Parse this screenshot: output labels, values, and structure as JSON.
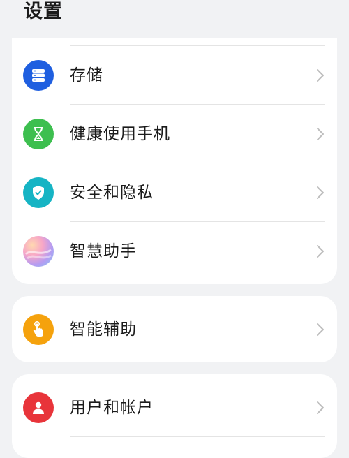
{
  "header": {
    "title": "设置"
  },
  "groups": [
    {
      "items": [
        {
          "label": "存储",
          "icon": "storage-icon",
          "color": "#1f5fe0"
        },
        {
          "label": "健康使用手机",
          "icon": "hourglass-icon",
          "color": "#3dbf4f"
        },
        {
          "label": "安全和隐私",
          "icon": "shield-check-icon",
          "color": "#16b4c4"
        },
        {
          "label": "智慧助手",
          "icon": "assistant-icon",
          "color": "#c9a3f5"
        }
      ]
    },
    {
      "items": [
        {
          "label": "智能辅助",
          "icon": "hand-tap-icon",
          "color": "#f5a20d"
        }
      ]
    },
    {
      "items": [
        {
          "label": "用户和帐户",
          "icon": "user-icon",
          "color": "#e8343a"
        }
      ]
    }
  ]
}
